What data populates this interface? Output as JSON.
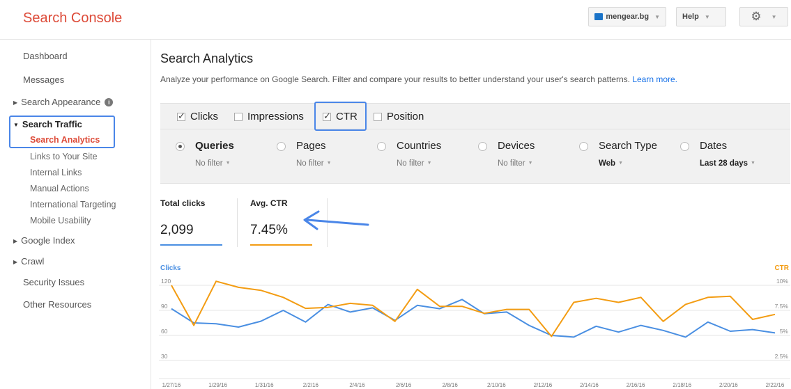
{
  "header": {
    "brand": "Search Console",
    "site": "mengear.bg",
    "help": "Help"
  },
  "sidebar": {
    "items": [
      {
        "label": "Dashboard"
      },
      {
        "label": "Messages"
      },
      {
        "label": "Search Appearance"
      },
      {
        "label": "Search Traffic"
      },
      {
        "label": "Search Analytics"
      },
      {
        "label": "Links to Your Site"
      },
      {
        "label": "Internal Links"
      },
      {
        "label": "Manual Actions"
      },
      {
        "label": "International Targeting"
      },
      {
        "label": "Mobile Usability"
      },
      {
        "label": "Google Index"
      },
      {
        "label": "Crawl"
      },
      {
        "label": "Security Issues"
      },
      {
        "label": "Other Resources"
      }
    ]
  },
  "main": {
    "title": "Search Analytics",
    "subtitle": "Analyze your performance on Google Search. Filter and compare your results to better understand your user's search patterns.",
    "learn_more": "Learn more."
  },
  "metrics": [
    {
      "label": "Clicks",
      "checked": true
    },
    {
      "label": "Impressions",
      "checked": false
    },
    {
      "label": "CTR",
      "checked": true
    },
    {
      "label": "Position",
      "checked": false
    }
  ],
  "dimensions": [
    {
      "label": "Queries",
      "sub": "No filter",
      "selected": true
    },
    {
      "label": "Pages",
      "sub": "No filter",
      "selected": false
    },
    {
      "label": "Countries",
      "sub": "No filter",
      "selected": false
    },
    {
      "label": "Devices",
      "sub": "No filter",
      "selected": false
    },
    {
      "label": "Search Type",
      "sub": "Web",
      "selected": false
    },
    {
      "label": "Dates",
      "sub": "Last 28 days",
      "selected": false
    }
  ],
  "summary": {
    "clicks_label": "Total clicks",
    "clicks_value": "2,099",
    "ctr_label": "Avg. CTR",
    "ctr_value": "7.45%"
  },
  "colors": {
    "clicks": "#4a8fe2",
    "ctr": "#f39c12",
    "brand": "#dd4b39",
    "highlight": "#4a86e8"
  },
  "chart_data": {
    "type": "line",
    "left_axis_label": "Clicks",
    "right_axis_label": "CTR",
    "left_ticks": [
      "120",
      "90",
      "60",
      "30"
    ],
    "right_ticks": [
      "10%",
      "7.5%",
      "5%",
      "2.5%"
    ],
    "ylim_left": [
      30,
      120
    ],
    "ylim_right": [
      2.5,
      10
    ],
    "x_labels": [
      "1/27/16",
      "1/29/16",
      "1/31/16",
      "2/2/16",
      "2/4/16",
      "2/6/16",
      "2/8/16",
      "2/10/16",
      "2/12/16",
      "2/14/16",
      "2/16/16",
      "2/18/16",
      "2/20/16",
      "2/22/16"
    ],
    "series": [
      {
        "name": "Clicks",
        "axis": "left",
        "values": [
          92,
          75,
          74,
          70,
          77,
          90,
          76,
          97,
          88,
          93,
          78,
          96,
          92,
          103,
          86,
          88,
          72,
          60,
          58,
          71,
          64,
          72,
          66,
          58,
          76,
          65,
          67,
          63
        ]
      },
      {
        "name": "CTR",
        "axis": "right",
        "values": [
          10,
          6,
          10.4,
          9.8,
          9.5,
          8.8,
          7.7,
          7.8,
          8.2,
          8.0,
          6.4,
          9.6,
          7.9,
          7.9,
          7.2,
          7.6,
          7.6,
          4.9,
          8.3,
          8.7,
          8.3,
          8.8,
          6.4,
          8.1,
          8.8,
          8.9,
          6.6,
          7.1
        ]
      }
    ]
  }
}
